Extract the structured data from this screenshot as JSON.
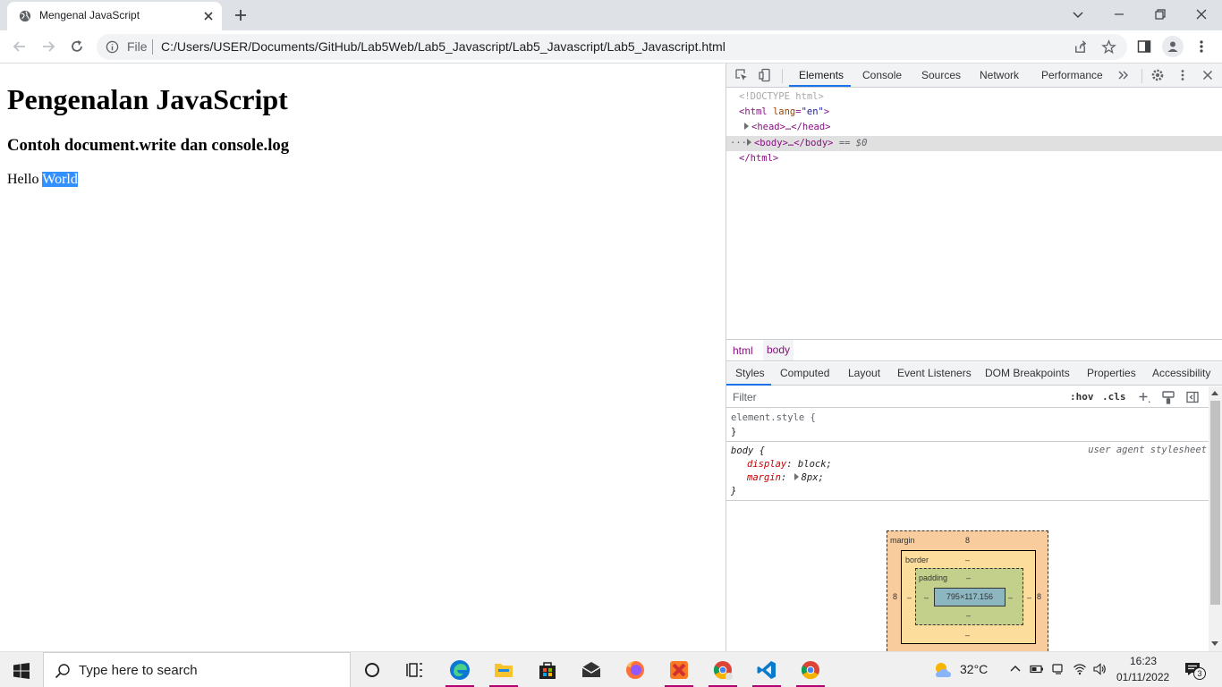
{
  "tab": {
    "title": "Mengenal JavaScript"
  },
  "omnibox": {
    "scheme_label": "File",
    "url": "C:/Users/USER/Documents/GitHub/Lab5Web/Lab5_Javascript/Lab5_Javascript/Lab5_Javascript.html"
  },
  "page": {
    "heading": "Pengenalan JavaScript",
    "subheading": "Contoh document.write dan console.log",
    "hello": "Hello",
    "world": "World"
  },
  "devtools": {
    "tabs": [
      "Elements",
      "Console",
      "Sources",
      "Network",
      "Performance"
    ],
    "active_tab": "Elements",
    "dom": {
      "doctype": "<!DOCTYPE html>",
      "html_open": "<html",
      "lang_attr": "lang",
      "lang_val": "\"en\"",
      "head": "<head>…</head>",
      "body_open": "<body>…</body>",
      "body_ref": "== $0",
      "html_close": "</html>",
      "dots": "···"
    },
    "breadcrumbs": [
      "html",
      "body"
    ],
    "style_tabs": [
      "Styles",
      "Computed",
      "Layout",
      "Event Listeners",
      "DOM Breakpoints",
      "Properties",
      "Accessibility"
    ],
    "filter": {
      "placeholder": "Filter",
      "hov": ":hov",
      "cls": ".cls"
    },
    "element_style": {
      "selector": "element.style {",
      "close": "}"
    },
    "body_rule": {
      "selector": "body {",
      "source": "user agent stylesheet",
      "props": [
        {
          "name": "display",
          "value": "block;"
        },
        {
          "name": "margin",
          "value": "8px;"
        }
      ],
      "close": "}"
    },
    "box_model": {
      "margin_label": "margin",
      "margin_value": "8",
      "border_label": "border",
      "padding_label": "padding",
      "dash": "–",
      "content": "795×117.156",
      "side_value": "8"
    }
  },
  "taskbar": {
    "search_placeholder": "Type here to search",
    "weather": "32°C",
    "time": "16:23",
    "date": "01/11/2022",
    "notifications": "3"
  }
}
